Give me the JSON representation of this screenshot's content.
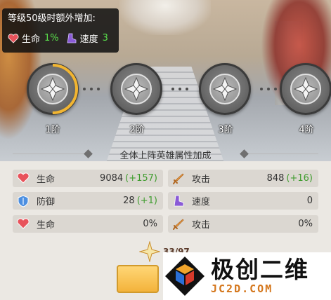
{
  "level_bonus": {
    "title": "等级50级时额外增加:",
    "hp_label": "生命",
    "hp_value": "1%",
    "speed_label": "速度",
    "speed_value": "3",
    "heart_icon": "heart-icon",
    "boot_icon": "boot-icon"
  },
  "tiers": [
    {
      "label": "1阶",
      "progress": 0.5
    },
    {
      "label": "2阶",
      "progress": 0
    },
    {
      "label": "3阶",
      "progress": 0
    },
    {
      "label": "4阶",
      "progress": 0
    }
  ],
  "section_title": "全体上阵英雄属性加成",
  "stats": [
    {
      "icon": "heart-icon",
      "name": "生命",
      "value": "9084",
      "bonus": "(+157)"
    },
    {
      "icon": "sword-icon",
      "name": "攻击",
      "value": "848",
      "bonus": "(+16)"
    },
    {
      "icon": "shield-icon",
      "name": "防御",
      "value": "28",
      "bonus": "(+1)"
    },
    {
      "icon": "boot-icon",
      "name": "速度",
      "value": "0",
      "bonus": ""
    },
    {
      "icon": "heart-icon",
      "name": "生命",
      "value": "0%",
      "bonus": ""
    },
    {
      "icon": "sword-icon",
      "name": "攻击",
      "value": "0%",
      "bonus": ""
    }
  ],
  "counter": "33/97",
  "watermark": {
    "title": "极创二维",
    "url": "JC2D.COM"
  },
  "colors": {
    "bonus_green": "#59e04c",
    "stat_bonus": "#3f9c2e",
    "progress_ring": "#f2b531",
    "accent_url": "#d4761b"
  }
}
